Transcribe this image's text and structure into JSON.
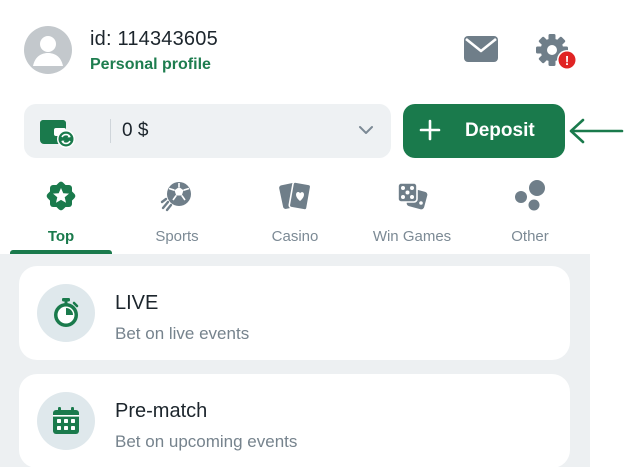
{
  "header": {
    "user_id": "id: 114343605",
    "profile_link": "Personal profile",
    "mail_icon": "mail-icon",
    "settings_icon": "gear-icon",
    "alert_badge": "!"
  },
  "balance": {
    "amount": "0 $",
    "wallet_icon": "wallet-icon"
  },
  "deposit": {
    "plus": "+",
    "label": "Deposit"
  },
  "tabs": [
    {
      "label": "Top",
      "icon": "star-badge-icon",
      "active": true
    },
    {
      "label": "Sports",
      "icon": "soccer-ball-icon",
      "active": false
    },
    {
      "label": "Casino",
      "icon": "playing-cards-icon",
      "active": false
    },
    {
      "label": "Win Games",
      "icon": "dice-icon",
      "active": false
    },
    {
      "label": "Other",
      "icon": "bubbles-icon",
      "active": false
    }
  ],
  "cards": [
    {
      "title": "LIVE",
      "subtitle": "Bet on live events",
      "icon": "stopwatch-icon"
    },
    {
      "title": "Pre-match",
      "subtitle": "Bet on upcoming events",
      "icon": "calendar-icon"
    }
  ],
  "colors": {
    "brand_green": "#1a7a4c",
    "alert_red": "#e02424",
    "icon_gray": "#6f7e89",
    "content_bg": "#edf0f2"
  }
}
